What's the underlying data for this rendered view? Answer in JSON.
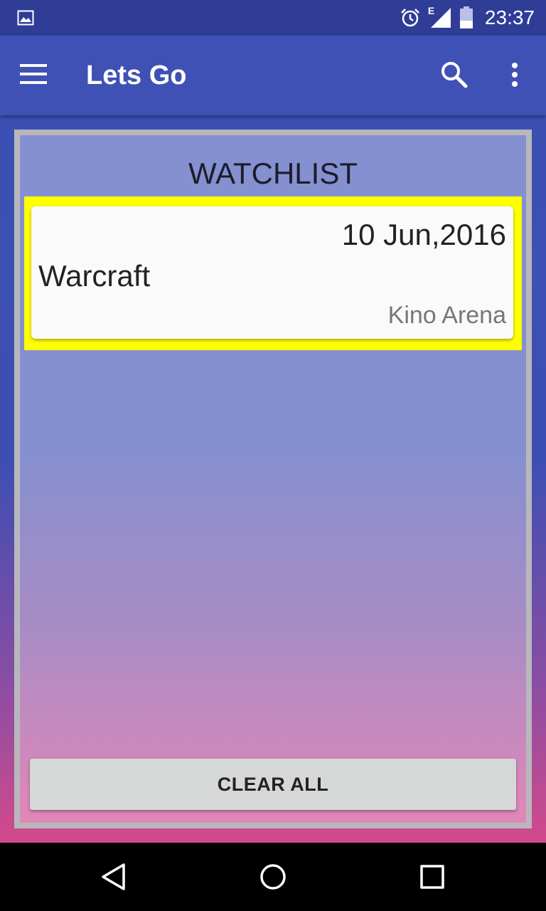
{
  "status_bar": {
    "time": "23:37",
    "network_label": "E",
    "icons": [
      "image-notification-icon",
      "alarm-icon",
      "signal-icon",
      "battery-icon"
    ]
  },
  "app_bar": {
    "title": "Lets Go",
    "icons": [
      "hamburger-menu-icon",
      "search-icon",
      "more-vert-icon"
    ]
  },
  "watchlist": {
    "title": "WATCHLIST",
    "items": [
      {
        "date": "10 Jun,2016",
        "title": "Warcraft",
        "venue": "Kino Arena"
      }
    ],
    "clear_label": "CLEAR ALL"
  },
  "nav_bar": {
    "icons": [
      "back-icon",
      "home-icon",
      "recents-icon"
    ]
  },
  "colors": {
    "status_bar": "#2f3d96",
    "app_bar": "#3f51b5",
    "highlight": "#ffff00",
    "card": "#fafafa",
    "button": "#d6d7d7",
    "gradient_bottom": "#d34a8c"
  }
}
